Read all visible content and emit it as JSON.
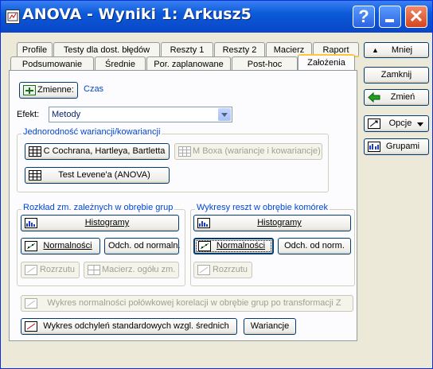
{
  "window": {
    "title": "ANOVA - Wyniki 1: Arkusz5"
  },
  "tabs_row1": [
    "Profile",
    "Testy dla dost. błędów",
    "Reszty 1",
    "Reszty 2",
    "Macierz",
    "Raport"
  ],
  "tabs_row2": [
    "Podsumowanie",
    "Średnie",
    "Por. zaplanowane",
    "Post-hoc",
    "Założenia"
  ],
  "active_tab": "Założenia",
  "variables": {
    "button": "Zmienne:",
    "value": "Czas"
  },
  "effect": {
    "label": "Efekt:",
    "value": "Metody"
  },
  "homogeneity": {
    "title": "Jednorodność wariancji/kowariancji",
    "cochran": "C Cochrana, Hartleya, Bartletta",
    "box_m": "M Boxa (wariancje i kowariancje)",
    "levene": "Test Levene'a (ANOVA)"
  },
  "within_groups": {
    "title": "Rozkład zm. zależnych w obrębie grup",
    "histograms": "Histogramy",
    "normality": "Normalności",
    "normality_dev": "Odch. od normaln.",
    "scatter": "Rozrzutu",
    "matrix": "Macierz. ogółu zm."
  },
  "residual_plots": {
    "title": "Wykresy reszt w obrębie komórek",
    "histograms": "Histogramy",
    "normality": "Normalności",
    "normality_dev": "Odch. od norm.",
    "scatter": "Rozrzutu"
  },
  "halfnormal_plot": "Wykres normalności połówkowej korelacji w obrębie grup po transformacji Z",
  "std_dev_plot": "Wykres odchyleń standardowych wzgl. średnich",
  "variances": "Wariancje",
  "side_buttons": {
    "less": "Mniej",
    "close": "Zamknij",
    "change": "Zmień",
    "options": "Opcje",
    "groups": "Grupami"
  }
}
